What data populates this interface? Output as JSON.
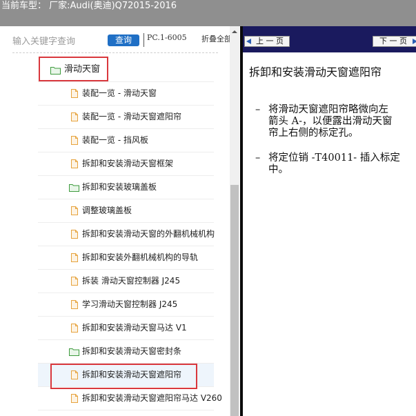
{
  "header": {
    "title": "当前车型： 厂家:Audi(奥迪)Q72015-2016"
  },
  "sidebar": {
    "search_placeholder": "输入关键字查询",
    "search_button": "查询",
    "pc_code": "PC.1-6005",
    "collapse_all": "折叠全部",
    "tree": [
      {
        "label": "滑动天窗",
        "type": "folder",
        "level": 1
      },
      {
        "label": "装配一览 - 滑动天窗",
        "type": "doc",
        "level": 2
      },
      {
        "label": "装配一览 - 滑动天窗遮阳帘",
        "type": "doc",
        "level": 2
      },
      {
        "label": "装配一览 - 挡风板",
        "type": "doc",
        "level": 2
      },
      {
        "label": "拆卸和安装滑动天窗框架",
        "type": "doc",
        "level": 2
      },
      {
        "label": "拆卸和安装玻璃盖板",
        "type": "folder",
        "level": 2
      },
      {
        "label": "调整玻璃盖板",
        "type": "doc",
        "level": 2
      },
      {
        "label": "拆卸和安装滑动天窗的外翻机械机构",
        "type": "doc",
        "level": 2
      },
      {
        "label": "拆卸和安装外翻机械机构的导轨",
        "type": "doc",
        "level": 2
      },
      {
        "label": "拆装 滑动天窗控制器 J245",
        "type": "doc",
        "level": 2
      },
      {
        "label": "学习滑动天窗控制器 J245",
        "type": "doc",
        "level": 2
      },
      {
        "label": "拆卸和安装滑动天窗马达 V1",
        "type": "doc",
        "level": 2
      },
      {
        "label": "拆卸和安装滑动天窗密封条",
        "type": "folder",
        "level": 2
      },
      {
        "label": "拆卸和安装滑动天窗遮阳帘",
        "type": "doc",
        "level": 2,
        "selected": true
      },
      {
        "label": "拆卸和安装滑动天窗遮阳帘马达 V260",
        "type": "doc",
        "level": 2
      }
    ]
  },
  "viewer": {
    "prev_label": "上 一 页",
    "next_label": "下 一 页",
    "title": "拆卸和安装滑动天窗遮阳帘",
    "steps": [
      {
        "bullet": "–",
        "lines": [
          "将滑动天窗遮阳帘略微向左",
          "箭头 A-，以便露出滑动天窗",
          "帘上右侧的标定孔。"
        ]
      },
      {
        "bullet": "–",
        "lines": [
          "将定位销 -T40011- 插入标定",
          "中。"
        ]
      }
    ]
  },
  "colors": {
    "header_bg": "#8f8f8f",
    "search_button_bg": "#1f6fc5",
    "nav_bar_bg": "#1a1a5e",
    "highlight_border": "#d9373c",
    "folder_icon": "#3c9a3c",
    "doc_icon": "#e6a23c"
  },
  "icons": {
    "folder": "folder-icon",
    "doc": "document-icon",
    "prev": "arrow-left-icon",
    "next": "arrow-right-icon"
  }
}
